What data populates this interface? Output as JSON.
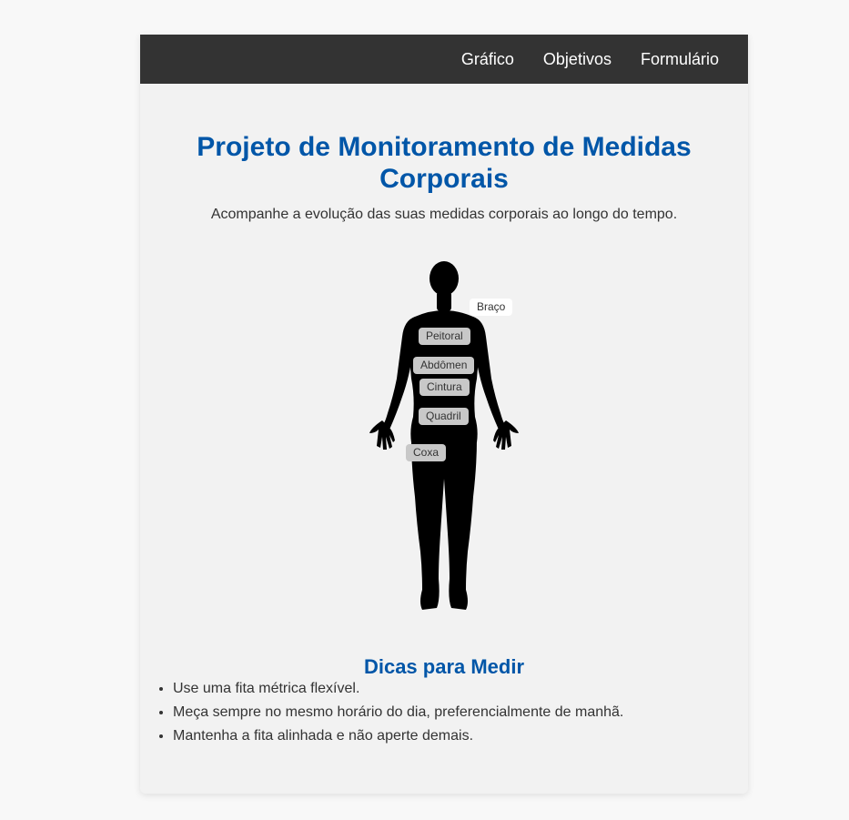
{
  "nav": {
    "items": [
      {
        "label": "Gráfico"
      },
      {
        "label": "Objetivos"
      },
      {
        "label": "Formulário"
      }
    ]
  },
  "header": {
    "title": "Projeto de Monitoramento de Medidas Corporais",
    "subtitle": "Acompanhe a evolução das suas medidas corporais ao longo do tempo."
  },
  "body_map": {
    "labels": {
      "arm": "Braço",
      "chest": "Peitoral",
      "abdomen": "Abdômen",
      "waist": "Cintura",
      "hip": "Quadril",
      "thigh": "Coxa"
    }
  },
  "tips": {
    "title": "Dicas para Medir",
    "items": [
      "Use uma fita métrica flexível.",
      "Meça sempre no mesmo horário do dia, preferencialmente de manhã.",
      "Mantenha a fita alinhada e não aperte demais."
    ]
  },
  "colors": {
    "navbar": "#333333",
    "heading": "#0056a8",
    "silhouette": "#000000"
  }
}
